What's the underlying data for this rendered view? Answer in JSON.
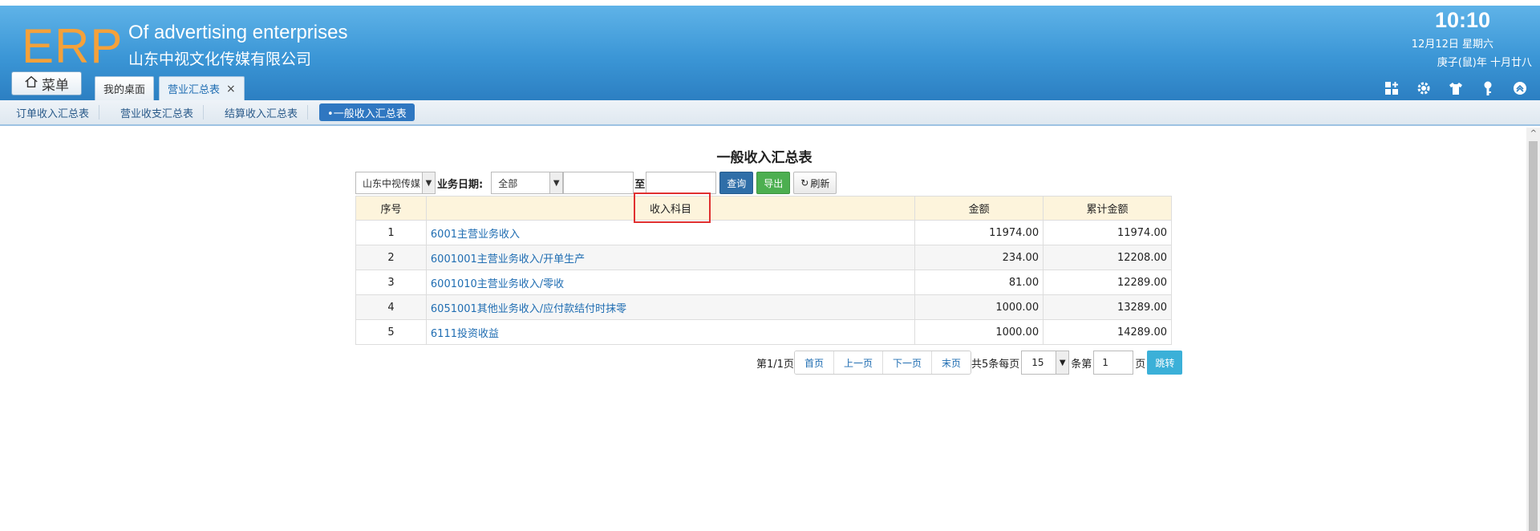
{
  "header": {
    "logo": "ERP",
    "company_en": "Of advertising enterprises",
    "company_cn": "山东中视文化传媒有限公司",
    "time": "10:10",
    "date": "12月12日 星期六",
    "lunar": "庚子(鼠)年 十月廿八",
    "menu_label": "菜单"
  },
  "tabs": [
    {
      "label": "我的桌面"
    },
    {
      "label": "营业汇总表",
      "close": "×"
    }
  ],
  "header_icons": [
    "dashboard-add-icon",
    "gear-icon",
    "shirt-icon",
    "key-icon",
    "chevron-up-circle-icon"
  ],
  "subnav": [
    {
      "label": "订单收入汇总表"
    },
    {
      "label": "营业收支汇总表"
    },
    {
      "label": "结算收入汇总表"
    },
    {
      "label": "•一般收入汇总表"
    }
  ],
  "page": {
    "title": "一般收入汇总表"
  },
  "toolbar": {
    "company_select": "山东中视传媒",
    "date_label": "业务日期:",
    "range_select": "全部",
    "to_label": "至",
    "query_btn": "查询",
    "export_btn": "导出",
    "refresh_btn": "刷新"
  },
  "table": {
    "headers": [
      "序号",
      "收入科目",
      "金额",
      "累计金额"
    ],
    "rows": [
      {
        "no": "1",
        "subject": "6001主营业务收入",
        "amount": "11974.00",
        "cumulative": "11974.00"
      },
      {
        "no": "2",
        "subject": "6001001主营业务收入/开单生产",
        "amount": "234.00",
        "cumulative": "12208.00"
      },
      {
        "no": "3",
        "subject": "6001010主营业务收入/零收",
        "amount": "81.00",
        "cumulative": "12289.00"
      },
      {
        "no": "4",
        "subject": "6051001其他业务收入/应付款结付时抹零",
        "amount": "1000.00",
        "cumulative": "13289.00"
      },
      {
        "no": "5",
        "subject": "6111投资收益",
        "amount": "1000.00",
        "cumulative": "14289.00"
      }
    ]
  },
  "pager": {
    "page_info": "第1/1页",
    "first": "首页",
    "prev": "上一页",
    "next": "下一页",
    "last": "末页",
    "total_text": "共5条每页",
    "page_size": "15",
    "goto_label": "条第",
    "goto_value": "1",
    "page_suffix": "页",
    "jump_btn": "跳转"
  }
}
